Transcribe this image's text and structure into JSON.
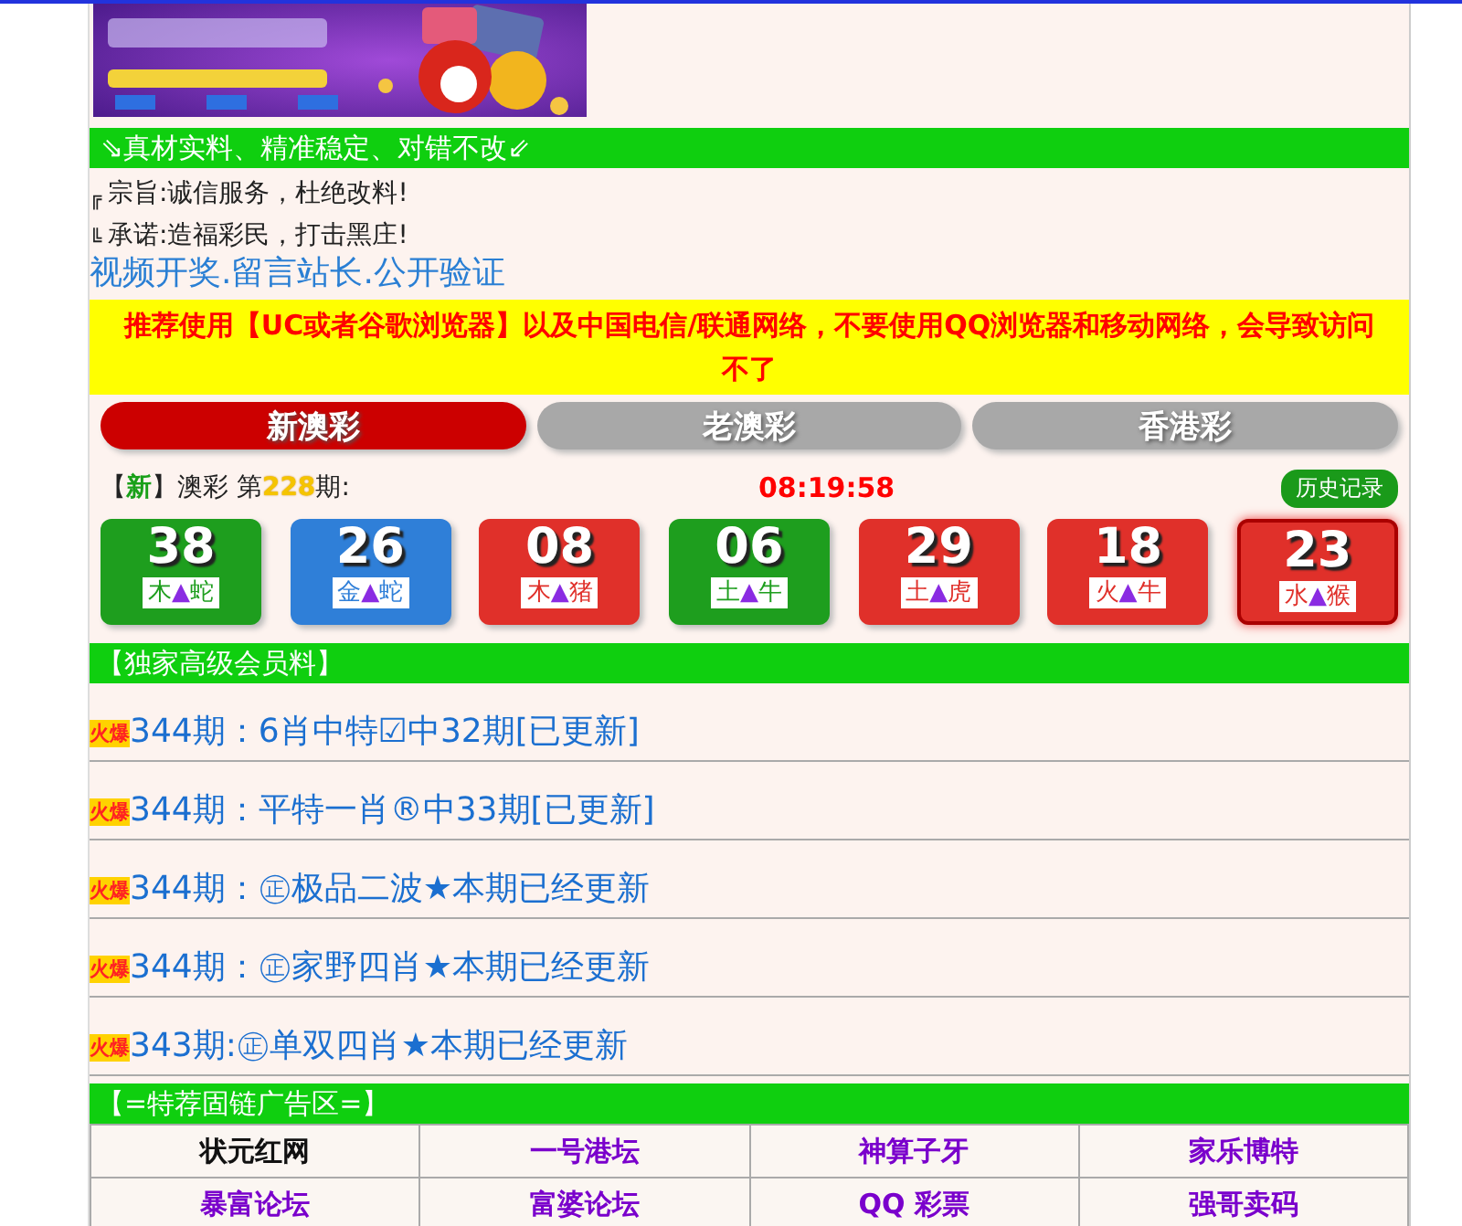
{
  "banner": {
    "kind": "picture"
  },
  "slogan_bar": "⇘真材实料、精准稳定、对错不改⇙",
  "notes": [
    {
      "mark": "╔",
      "text": "宗旨:诚信服务，杜绝改料!"
    },
    {
      "mark": "╚",
      "text": "承诺:造福彩民，打击黑庄!"
    }
  ],
  "links": "视频开奖.留言站长.公开验证",
  "warning": "推荐使用【UC或者谷歌浏览器】以及中国电信/联通网络，不要使用QQ浏览器和移动网络，会导致访问不了",
  "tabs": [
    {
      "label": "新澳彩",
      "selected": true
    },
    {
      "label": "老澳彩",
      "selected": false
    },
    {
      "label": "香港彩",
      "selected": false
    }
  ],
  "draw": {
    "open": "【",
    "badge": "新",
    "close": "】",
    "name": "澳彩 第",
    "issue": "228",
    "suffix": "期:",
    "time": "08:19:58",
    "history_button": "历史记录"
  },
  "balls": [
    {
      "number": "38",
      "color": "#1e9e1e",
      "element": "木",
      "mark": "▲",
      "zodiac": "蛇",
      "selected": false
    },
    {
      "number": "26",
      "color": "#2f7fd8",
      "element": "金",
      "mark": "▲",
      "zodiac": "蛇",
      "selected": false
    },
    {
      "number": "08",
      "color": "#e0302a",
      "element": "木",
      "mark": "▲",
      "zodiac": "猪",
      "selected": false
    },
    {
      "number": "06",
      "color": "#1e9e1e",
      "element": "土",
      "mark": "▲",
      "zodiac": "牛",
      "selected": false
    },
    {
      "number": "29",
      "color": "#e0302a",
      "element": "土",
      "mark": "▲",
      "zodiac": "虎",
      "selected": false
    },
    {
      "number": "18",
      "color": "#e0302a",
      "element": "火",
      "mark": "▲",
      "zodiac": "牛",
      "selected": false
    },
    {
      "number": "23",
      "color": "#e0302a",
      "element": "水",
      "mark": "▲",
      "zodiac": "猴",
      "selected": true
    }
  ],
  "vip_bar": "【独家高级会员料】",
  "vip_items": [
    {
      "badge": "火爆",
      "text": "344期：6肖中特☑中32期[已更新]"
    },
    {
      "badge": "火爆",
      "text": "344期：平特一肖®中33期[已更新]"
    },
    {
      "badge": "火爆",
      "text": "344期：㊣极品二波★本期已经更新"
    },
    {
      "badge": "火爆",
      "text": "344期：㊣家野四肖★本期已经更新"
    },
    {
      "badge": "火爆",
      "text": "343期:㊣单双四肖★本期已经更新"
    }
  ],
  "ads_bar": "【=特荐固链广告区=】",
  "ads": [
    [
      {
        "label": "状元红网",
        "kind": "plain"
      },
      {
        "label": "一号港坛",
        "kind": "link"
      },
      {
        "label": "神算子牙",
        "kind": "link"
      },
      {
        "label": "家乐博特",
        "kind": "link"
      }
    ],
    [
      {
        "label": "暴富论坛",
        "kind": "link"
      },
      {
        "label": "富婆论坛",
        "kind": "link"
      },
      {
        "label": "QQ 彩票",
        "kind": "link"
      },
      {
        "label": "强哥卖码",
        "kind": "link"
      }
    ]
  ]
}
